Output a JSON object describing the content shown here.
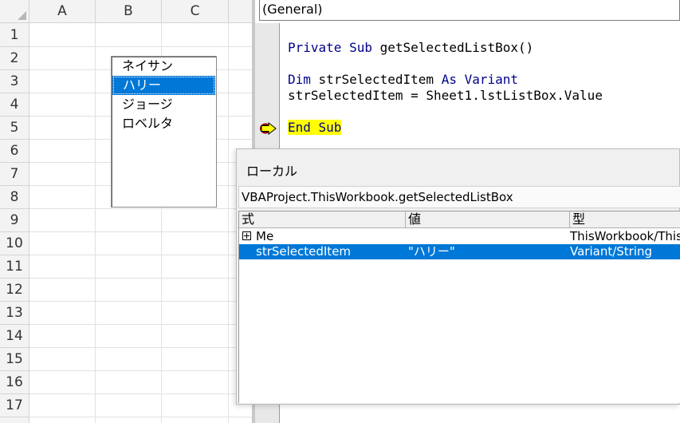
{
  "sheet": {
    "columns": [
      "A",
      "B",
      "C"
    ],
    "rows": [
      "1",
      "2",
      "3",
      "4",
      "5",
      "6",
      "7",
      "8",
      "9",
      "10",
      "11",
      "12",
      "13",
      "14",
      "15",
      "16",
      "17"
    ],
    "listbox": {
      "items": [
        "ネイサン",
        "ハリー",
        "ジョージ",
        "ロベルタ"
      ],
      "selected_index": 1
    }
  },
  "vbe": {
    "object_combo": "(General)",
    "code": {
      "line1_kw1": "Private",
      "line1_kw2": "Sub",
      "line1_rest": "getSelectedListBox()",
      "line2_kw1": "Dim",
      "line2_mid": "strSelectedItem",
      "line2_kw2": "As",
      "line2_kw3": "Variant",
      "line3": "strSelectedItem = Sheet1.lstListBox.Value",
      "line4": "End Sub"
    },
    "exec_arrow_icon": "execution-pointer-icon"
  },
  "locals": {
    "title": "ローカル",
    "context": "VBAProject.ThisWorkbook.getSelectedListBox",
    "headers": {
      "expr": "式",
      "value": "値",
      "type": "型"
    },
    "rows": [
      {
        "expr": "Me",
        "value": "",
        "type": "ThisWorkbook/ThisWorkbook",
        "expandable": true
      },
      {
        "expr": "strSelectedItem",
        "value": "\"ハリー\"",
        "type": "Variant/String",
        "selected": true
      }
    ]
  },
  "colors": {
    "selection": "#0078d7",
    "keyword": "#00008b",
    "exec_highlight": "#ffff00"
  }
}
